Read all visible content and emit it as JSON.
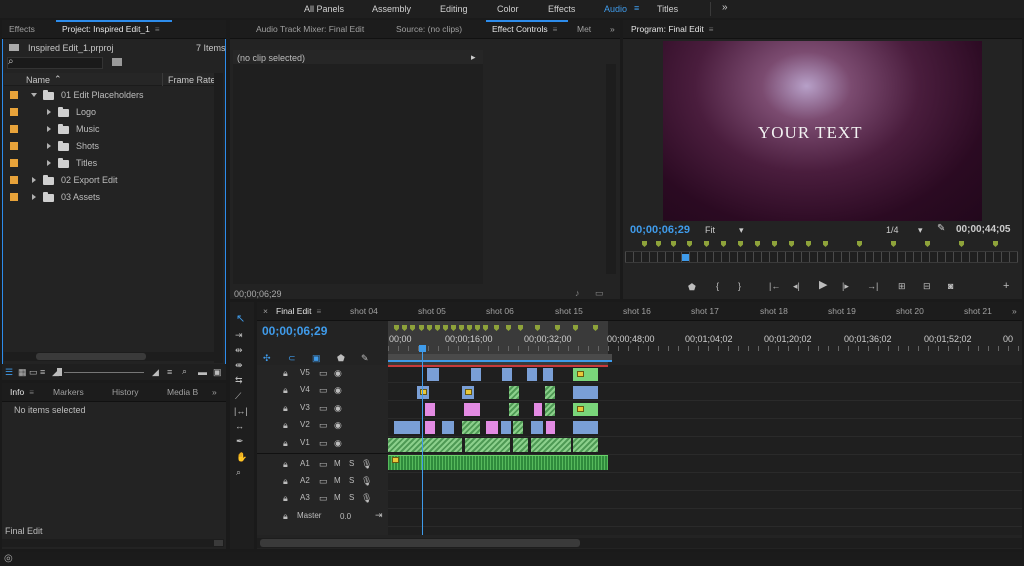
{
  "workspaces": {
    "items": [
      "All Panels",
      "Assembly",
      "Editing",
      "Color",
      "Effects",
      "Audio",
      "Titles"
    ],
    "active": "Audio",
    "more": "»"
  },
  "project": {
    "tabs": [
      "Effects",
      "Project: Inspired Edit_1"
    ],
    "file": "Inspired Edit_1.prproj",
    "count": "7 Items",
    "col_name": "Name",
    "col_rate": "Frame Rate",
    "rows": [
      {
        "name": "01 Edit Placeholders",
        "level": 0,
        "open": true
      },
      {
        "name": "Logo",
        "level": 1,
        "open": false
      },
      {
        "name": "Music",
        "level": 1,
        "open": false
      },
      {
        "name": "Shots",
        "level": 1,
        "open": false
      },
      {
        "name": "Titles",
        "level": 1,
        "open": false
      },
      {
        "name": "02 Export Edit",
        "level": 0,
        "open": false
      },
      {
        "name": "03 Assets",
        "level": 0,
        "open": false
      }
    ]
  },
  "effect_controls": {
    "tabs": [
      "Audio Track Mixer: Final Edit",
      "Source: (no clips)",
      "Effect Controls",
      "Met"
    ],
    "no_clip": "(no clip selected)",
    "timecode": "00;00;06;29"
  },
  "program": {
    "tab": "Program: Final Edit",
    "overlay_text": "YOUR TEXT",
    "timecode": "00;00;06;29",
    "fit": "Fit",
    "resolution": "1/4",
    "duration": "00;00;44;05"
  },
  "info": {
    "tabs": [
      "Info",
      "Markers",
      "History",
      "Media B"
    ],
    "no_items": "No items selected",
    "sequence": "Final Edit"
  },
  "timeline": {
    "tabs": [
      "Final Edit",
      "shot 04",
      "shot 05",
      "shot 06",
      "shot 15",
      "shot 16",
      "shot 17",
      "shot 18",
      "shot 19",
      "shot 20",
      "shot 21"
    ],
    "timecode": "00;00;06;29",
    "ruler": [
      "00;00",
      "00;00;16;00",
      "00;00;32;00",
      "00;00;48;00",
      "00;01;04;02",
      "00;01;20;02",
      "00;01;36;02",
      "00;01;52;02",
      "00"
    ],
    "video_tracks": [
      "V5",
      "V4",
      "V3",
      "V2",
      "V1"
    ],
    "audio_tracks": [
      "A1",
      "A2",
      "A3"
    ],
    "audio_m": "M",
    "audio_s": "S",
    "master": "Master",
    "master_value": "0.0"
  },
  "colors": {
    "accent": "#3f9bea",
    "label_orange": "#e8a33a",
    "clip_blue": "#7a9fd6",
    "clip_pink": "#e38be3",
    "clip_green": "#7ad67a"
  }
}
